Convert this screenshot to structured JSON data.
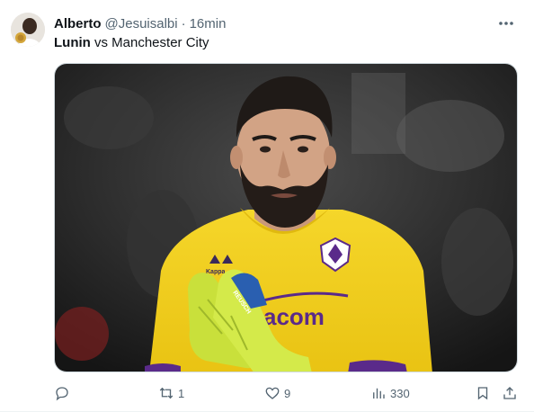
{
  "tweet": {
    "author_name": "Alberto",
    "handle": "@Jesuisalbi",
    "separator": "·",
    "time": "16min",
    "text_bold": "Lunin",
    "text_rest": " vs Manchester City"
  },
  "media": {
    "jersey_sponsor": "acom",
    "jersey_brand": "Kappa",
    "glove_brand": "REUSCH",
    "colors": {
      "jersey": "#f2d21b",
      "trim": "#5a2a8a",
      "gloves": "#c7df3a"
    }
  },
  "actions": {
    "replies": "",
    "reposts": "1",
    "likes": "9",
    "views": "330"
  }
}
